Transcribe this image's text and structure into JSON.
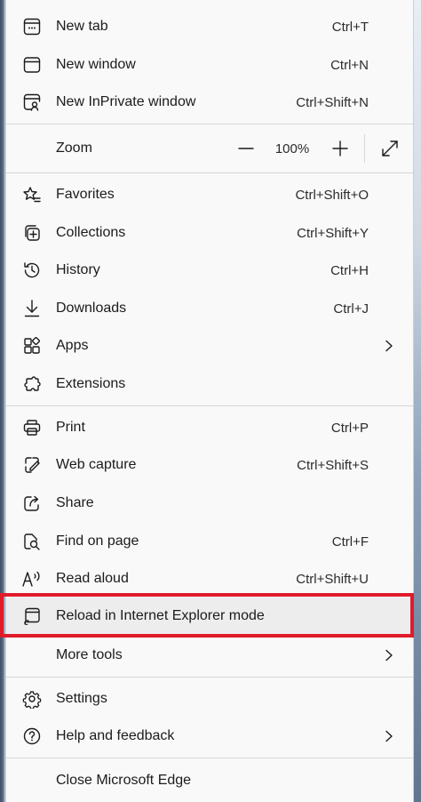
{
  "menu": {
    "items_top": [
      {
        "label": "New tab",
        "shortcut": "Ctrl+T",
        "icon": "new-tab-icon"
      },
      {
        "label": "New window",
        "shortcut": "Ctrl+N",
        "icon": "new-window-icon"
      },
      {
        "label": "New InPrivate window",
        "shortcut": "Ctrl+Shift+N",
        "icon": "inprivate-icon"
      }
    ],
    "zoom": {
      "label": "Zoom",
      "minus": "—",
      "value": "100%",
      "plus": "+"
    },
    "items_mid": [
      {
        "label": "Favorites",
        "shortcut": "Ctrl+Shift+O",
        "icon": "favorites-icon"
      },
      {
        "label": "Collections",
        "shortcut": "Ctrl+Shift+Y",
        "icon": "collections-icon"
      },
      {
        "label": "History",
        "shortcut": "Ctrl+H",
        "icon": "history-icon"
      },
      {
        "label": "Downloads",
        "shortcut": "Ctrl+J",
        "icon": "downloads-icon"
      },
      {
        "label": "Apps",
        "shortcut": "",
        "icon": "apps-icon"
      },
      {
        "label": "Extensions",
        "shortcut": "",
        "icon": "extensions-icon"
      }
    ],
    "items_tools": [
      {
        "label": "Print",
        "shortcut": "Ctrl+P",
        "icon": "print-icon"
      },
      {
        "label": "Web capture",
        "shortcut": "Ctrl+Shift+S",
        "icon": "web-capture-icon"
      },
      {
        "label": "Share",
        "shortcut": "",
        "icon": "share-icon"
      },
      {
        "label": "Find on page",
        "shortcut": "Ctrl+F",
        "icon": "find-icon"
      },
      {
        "label": "Read aloud",
        "shortcut": "Ctrl+Shift+U",
        "icon": "read-aloud-icon"
      },
      {
        "label": "Reload in Internet Explorer mode",
        "shortcut": "",
        "icon": "ie-mode-icon"
      },
      {
        "label": "More tools",
        "shortcut": "",
        "icon": ""
      }
    ],
    "items_bottom": [
      {
        "label": "Settings",
        "shortcut": "",
        "icon": "settings-icon"
      },
      {
        "label": "Help and feedback",
        "shortcut": "",
        "icon": "help-icon"
      }
    ],
    "close": {
      "label": "Close Microsoft Edge"
    }
  },
  "colors": {
    "highlight_border": "#e01b2a",
    "menu_bg": "#f9f9f9",
    "hover_bg": "#ededed"
  }
}
